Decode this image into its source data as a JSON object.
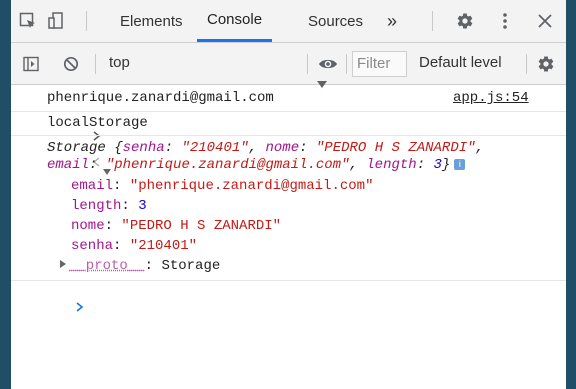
{
  "tabs": {
    "elements": "Elements",
    "console": "Console",
    "sources": "Sources",
    "more": "»"
  },
  "toolbar": {
    "context": "top",
    "filter_placeholder": "Filter",
    "level": "Default level"
  },
  "console": {
    "log_message": "phenrique.zanardi@gmail.com",
    "log_source": "app.js:54",
    "input_command": "localStorage",
    "result": {
      "summary_prefix": "Storage {",
      "senha_key": "senha",
      "senha_value": "\"210401\"",
      "nome_key": "nome",
      "nome_value": "\"PEDRO H S ZANARDI\"",
      "email_key": "email",
      "email_value": "\"phenrique.zanardi@gmail.com\"",
      "length_key": "length",
      "length_value": "3",
      "summary_suffix": "}",
      "proto_key": "__proto__",
      "proto_value": "Storage"
    }
  },
  "colors": {
    "accent": "#1a73e8",
    "string": "#c41a16",
    "key": "#a3158e",
    "number": "#1c00cf"
  }
}
